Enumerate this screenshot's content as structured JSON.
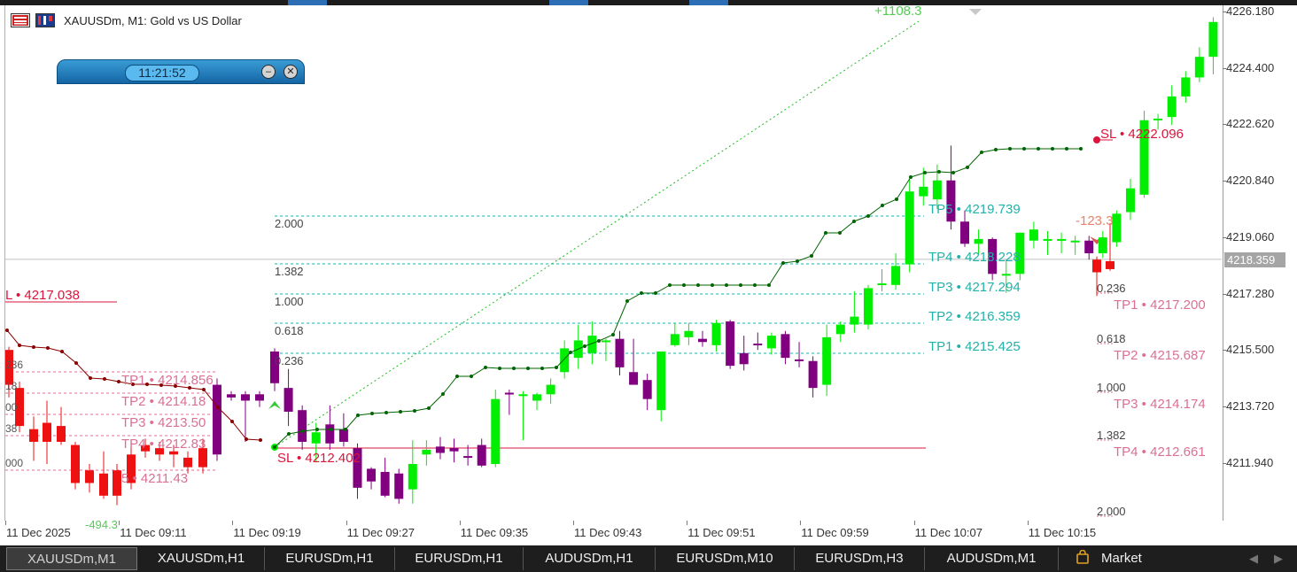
{
  "window": {
    "title": "XAUUSDm, M1:  Gold vs US Dollar"
  },
  "clock_panel": {
    "time": "11:21:52",
    "minimize_glyph": "–",
    "close_glyph": "✕"
  },
  "price_axis": {
    "ticks": [
      "4226.180",
      "4224.400",
      "4222.620",
      "4220.840",
      "4219.060",
      "4217.280",
      "4215.500",
      "4213.720",
      "4211.940"
    ],
    "current_price": "4218.359"
  },
  "time_axis": {
    "ticks": [
      "11 Dec 2025",
      "11 Dec 09:11",
      "11 Dec 09:19",
      "11 Dec 09:27",
      "11 Dec 09:35",
      "11 Dec 09:43",
      "11 Dec 09:51",
      "11 Dec 09:59",
      "11 Dec 10:07",
      "11 Dec 10:15"
    ]
  },
  "colors": {
    "bull": "#00ee00",
    "bear": "#ee1111",
    "bear_alt": "#800080",
    "trailing_line": "#006400",
    "teal_levels": "#20b2aa",
    "pink_levels": "#db7093",
    "stop_loss": "#dc143c",
    "tab_bar": "#1e1e1e"
  },
  "long_setup": {
    "levels": [
      {
        "ratio": "2.000",
        "tp": "TP5 • 4219.739"
      },
      {
        "ratio": "1.382",
        "tp": "TP4 • 4218.228"
      },
      {
        "ratio": "1.000",
        "tp": "TP3 • 4217.294"
      },
      {
        "ratio": "0.618",
        "tp": "TP2 • 4216.359"
      },
      {
        "ratio": "0.236",
        "tp": "TP1 • 4215.425"
      }
    ],
    "stop_loss": "SL • 4212.402",
    "points": "+1108.3"
  },
  "prior_short_setup": {
    "stop_loss": "L • 4217.038",
    "levels": [
      {
        "ratio": "236",
        "tp": "TP1 • 4214.856"
      },
      {
        "ratio": "18",
        "tp": "TP2 • 4214.18"
      },
      {
        "ratio": "00",
        "tp": "TP3 • 4213.50"
      },
      {
        "ratio": "38",
        "tp": "TP4 • 4212.83"
      },
      {
        "ratio": "000",
        "tp": "5 • 4211.43"
      }
    ],
    "points": "-494.3"
  },
  "short_setup": {
    "stop_loss": "SL • 4222.096",
    "points": "-123.3",
    "levels": [
      {
        "ratio": "0.236",
        "tp": "TP1 • 4217.200"
      },
      {
        "ratio": "0.618",
        "tp": "TP2 • 4215.687"
      },
      {
        "ratio": "1.000",
        "tp": "TP3 • 4214.174"
      },
      {
        "ratio": "1.382",
        "tp": "TP4 • 4212.661"
      },
      {
        "ratio": "2.000",
        "tp": ""
      }
    ]
  },
  "candles": [
    {
      "o": 4215.45,
      "h": 4215.55,
      "l": 4214.2,
      "c": 4214.45
    },
    {
      "o": 4214.3,
      "h": 4214.9,
      "l": 4213.1,
      "c": 4213.55
    },
    {
      "o": 4213.6,
      "h": 4213.75,
      "l": 4212.35,
      "c": 4212.6
    },
    {
      "o": 4212.55,
      "h": 4213.2,
      "l": 4211.95,
      "c": 4212.9
    },
    {
      "o": 4213.15,
      "h": 4213.75,
      "l": 4212.35,
      "c": 4212.55
    },
    {
      "o": 4213.0,
      "h": 4213.5,
      "l": 4212.45,
      "c": 4212.6
    },
    {
      "o": 4212.4,
      "h": 4212.55,
      "l": 4210.8,
      "c": 4211.15
    },
    {
      "o": 4211.75,
      "h": 4211.8,
      "l": 4211.1,
      "c": 4211.35
    },
    {
      "o": 4211.65,
      "h": 4212.1,
      "l": 4210.85,
      "c": 4210.9
    },
    {
      "o": 4211.6,
      "h": 4211.75,
      "l": 4210.65,
      "c": 4210.8
    },
    {
      "o": 4211.1,
      "h": 4212.65,
      "l": 4210.65,
      "c": 4211.9
    },
    {
      "o": 4212.2,
      "h": 4212.65,
      "l": 4211.85,
      "c": 4212.35
    },
    {
      "o": 4212.45,
      "h": 4212.75,
      "l": 4212.05,
      "c": 4212.25
    },
    {
      "o": 4212.4,
      "h": 4212.7,
      "l": 4211.95,
      "c": 4212.3
    },
    {
      "o": 4212.15,
      "h": 4212.5,
      "l": 4211.85,
      "c": 4212.1
    },
    {
      "o": 4212.5,
      "h": 4212.7,
      "l": 4211.8,
      "c": 4211.85
    },
    {
      "o": 4211.9,
      "h": 4214.25,
      "l": 4211.8,
      "c": 4213.95
    },
    {
      "o": 4214.15,
      "h": 4214.25,
      "l": 4213.45,
      "c": 4214.1
    },
    {
      "o": 4214.1,
      "h": 4214.2,
      "l": 4212.65,
      "c": 4214.1
    },
    {
      "o": 4213.9,
      "h": 4214.15,
      "l": 4213.6,
      "c": 4214.1
    },
    {
      "o": 4214.1,
      "h": 4214.6,
      "l": 4213.8,
      "c": 4214.4
    },
    {
      "o": 4214.8,
      "h": 4215.8,
      "l": 4214.6,
      "c": 4215.55
    },
    {
      "o": 4215.25,
      "h": 4216.3,
      "l": 4214.9,
      "c": 4215.8
    },
    {
      "o": 4215.4,
      "h": 4216.4,
      "l": 4215.05,
      "c": 4215.95
    },
    {
      "o": 4215.75,
      "h": 4215.85,
      "l": 4215.15,
      "c": 4215.8
    },
    {
      "o": 4215.85,
      "h": 4216.1,
      "l": 4214.7,
      "c": 4214.95
    },
    {
      "o": 4214.8,
      "h": 4215.85,
      "l": 4214.45,
      "c": 4214.4
    },
    {
      "o": 4214.55,
      "h": 4214.75,
      "l": 4213.6,
      "c": 4213.95
    },
    {
      "o": 4213.6,
      "h": 4215.45,
      "l": 4213.25,
      "c": 4215.45
    },
    {
      "o": 4215.65,
      "h": 4216.35,
      "l": 4215.6,
      "c": 4216.0
    },
    {
      "o": 4215.9,
      "h": 4216.35,
      "l": 4215.65,
      "c": 4216.1
    },
    {
      "o": 4215.85,
      "h": 4216.1,
      "l": 4215.6,
      "c": 4215.75
    },
    {
      "o": 4215.65,
      "h": 4216.45,
      "l": 4215.45,
      "c": 4216.35
    },
    {
      "o": 4216.4,
      "h": 4216.45,
      "l": 4214.9,
      "c": 4215.0
    },
    {
      "o": 4215.4,
      "h": 4215.95,
      "l": 4214.85,
      "c": 4215.05
    },
    {
      "o": 4215.7,
      "h": 4216.05,
      "l": 4215.5,
      "c": 4215.65
    },
    {
      "o": 4215.55,
      "h": 4216.05,
      "l": 4215.35,
      "c": 4215.95
    },
    {
      "o": 4216.0,
      "h": 4216.1,
      "l": 4215.05,
      "c": 4215.25
    },
    {
      "o": 4215.2,
      "h": 4215.75,
      "l": 4214.95,
      "c": 4215.15
    },
    {
      "o": 4215.15,
      "h": 4215.3,
      "l": 4214.0,
      "c": 4214.3
    },
    {
      "o": 4214.4,
      "h": 4216.3,
      "l": 4214.05,
      "c": 4215.9
    },
    {
      "o": 4216.0,
      "h": 4216.4,
      "l": 4215.75,
      "c": 4216.3
    },
    {
      "o": 4216.3,
      "h": 4217.35,
      "l": 4216.05,
      "c": 4216.55
    },
    {
      "o": 4216.3,
      "h": 4217.55,
      "l": 4216.15,
      "c": 4217.45
    },
    {
      "o": 4217.55,
      "h": 4218.05,
      "l": 4217.35,
      "c": 4217.6
    },
    {
      "o": 4217.55,
      "h": 4218.55,
      "l": 4217.4,
      "c": 4218.15
    },
    {
      "o": 4218.2,
      "h": 4220.9,
      "l": 4217.95,
      "c": 4220.5
    },
    {
      "o": 4220.35,
      "h": 4221.25,
      "l": 4220.05,
      "c": 4220.65
    },
    {
      "o": 4220.25,
      "h": 4221.35,
      "l": 4219.95,
      "c": 4220.85
    },
    {
      "o": 4220.85,
      "h": 4221.95,
      "l": 4219.3,
      "c": 4219.55
    },
    {
      "o": 4219.55,
      "h": 4219.9,
      "l": 4218.75,
      "c": 4218.85
    },
    {
      "o": 4218.85,
      "h": 4219.3,
      "l": 4218.5,
      "c": 4219.0
    },
    {
      "o": 4219.0,
      "h": 4219.05,
      "l": 4217.7,
      "c": 4217.9
    },
    {
      "o": 4217.9,
      "h": 4218.35,
      "l": 4217.3,
      "c": 4217.9
    },
    {
      "o": 4217.9,
      "h": 4219.2,
      "l": 4217.7,
      "c": 4219.2
    },
    {
      "o": 4218.95,
      "h": 4219.55,
      "l": 4218.7,
      "c": 4219.3
    },
    {
      "o": 4218.95,
      "h": 4219.25,
      "l": 4218.5,
      "c": 4219.0
    },
    {
      "o": 4218.95,
      "h": 4219.2,
      "l": 4218.55,
      "c": 4219.0
    },
    {
      "o": 4218.95,
      "h": 4219.1,
      "l": 4218.5,
      "c": 4218.95
    },
    {
      "o": 4218.95,
      "h": 4219.1,
      "l": 4218.35,
      "c": 4218.55
    },
    {
      "o": 4218.55,
      "h": 4219.25,
      "l": 4218.4,
      "c": 4219.05
    },
    {
      "o": 4218.9,
      "h": 4219.9,
      "l": 4218.75,
      "c": 4219.8
    },
    {
      "o": 4219.85,
      "h": 4220.9,
      "l": 4219.6,
      "c": 4220.6
    },
    {
      "o": 4220.4,
      "h": 4223.05,
      "l": 4220.3,
      "c": 4222.75
    },
    {
      "o": 4222.75,
      "h": 4222.95,
      "l": 4222.45,
      "c": 4222.8
    },
    {
      "o": 4222.85,
      "h": 4223.85,
      "l": 4222.6,
      "c": 4223.5
    },
    {
      "o": 4223.5,
      "h": 4224.3,
      "l": 4223.3,
      "c": 4224.1
    },
    {
      "o": 4224.1,
      "h": 4225.05,
      "l": 4223.95,
      "c": 4224.75
    },
    {
      "o": 4224.75,
      "h": 4226.0,
      "l": 4224.2,
      "c": 4225.85
    },
    {
      "o": 4225.8,
      "h": 4225.9,
      "l": 4223.2,
      "c": 4223.4
    },
    {
      "o": 4223.4,
      "h": 4223.55,
      "l": 4222.4,
      "c": 4222.45
    },
    {
      "o": 4222.55,
      "h": 4223.05,
      "l": 4222.1,
      "c": 4222.75
    },
    {
      "o": 4222.8,
      "h": 4223.75,
      "l": 4222.45,
      "c": 4222.75
    },
    {
      "o": 4222.9,
      "h": 4223.2,
      "l": 4222.0,
      "c": 4222.5
    },
    {
      "o": 4222.5,
      "h": 4222.9,
      "l": 4220.75,
      "c": 4220.95
    },
    {
      "o": 4221.65,
      "h": 4221.75,
      "l": 4220.5,
      "c": 4220.75
    },
    {
      "o": 4221.65,
      "h": 4221.8,
      "l": 4220.45,
      "c": 4220.65
    },
    {
      "o": 4220.75,
      "h": 4220.9,
      "l": 4218.4,
      "c": 4220.3
    },
    {
      "o": 4219.65,
      "h": 4219.8,
      "l": 4218.55,
      "c": 4218.85
    },
    {
      "o": 4218.55,
      "h": 4218.6,
      "l": 4217.5,
      "c": 4218.25
    },
    {
      "o": 4218.4,
      "h": 4218.8,
      "l": 4218.1,
      "c": 4218.2
    }
  ],
  "tabs": [
    {
      "label": "XAUUSDm,M1",
      "active": true
    },
    {
      "label": "XAUUSDm,H1",
      "active": false
    },
    {
      "label": "EURUSDm,H1",
      "active": false
    },
    {
      "label": "EURUSDm,H1",
      "active": false
    },
    {
      "label": "AUDUSDm,H1",
      "active": false
    },
    {
      "label": "EURUSDm,M10",
      "active": false
    },
    {
      "label": "EURUSDm,H3",
      "active": false
    },
    {
      "label": "AUDUSDm,M1",
      "active": false
    },
    {
      "label": "Market",
      "active": false
    }
  ]
}
